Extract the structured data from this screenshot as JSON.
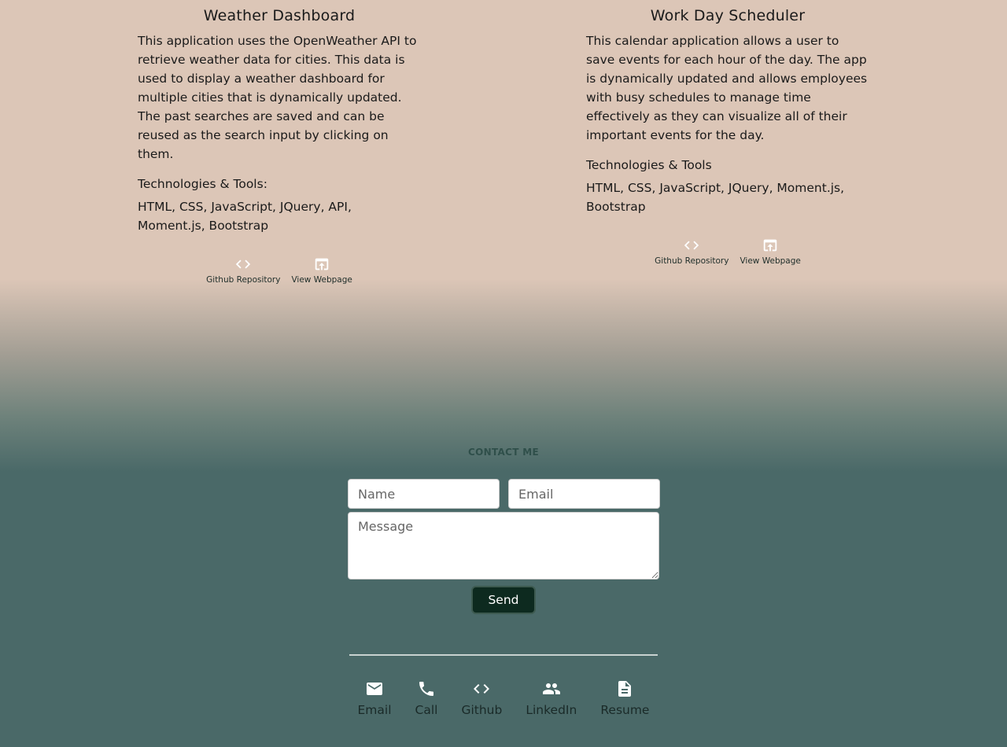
{
  "projects": [
    {
      "title": "Weather Dashboard",
      "description": "This application uses the OpenWeather API to retrieve weather data for cities. This data is used to display a weather dashboard for multiple cities that is dynamically updated. The past searches are saved and can be reused as the search input by clicking on them.",
      "tech_label": "Technologies & Tools:",
      "tech_list": "HTML, CSS, JavaScript, JQuery, API, Moment.js, Bootstrap",
      "repo_label": "Github Repository",
      "repo_icon": "code-icon",
      "webpage_label": "View Webpage",
      "webpage_icon": "open-in-browser-icon"
    },
    {
      "title": "Work Day Scheduler",
      "description": "This calendar application allows a user to save events for each hour of the day. The app is dynamically updated and allows employees with busy schedules to manage time effectively as they can visualize all of their important events for the day.",
      "tech_label": "Technologies & Tools",
      "tech_list": "HTML, CSS, JavaScript, JQuery, Moment.js, Bootstrap",
      "repo_label": "Github Repository",
      "repo_icon": "code-icon",
      "webpage_label": "View Webpage",
      "webpage_icon": "open-in-browser-icon"
    }
  ],
  "contact": {
    "heading": "CONTACT ME",
    "name_placeholder": "Name",
    "email_placeholder": "Email",
    "message_placeholder": "Message",
    "send_label": "Send"
  },
  "footer": {
    "items": [
      {
        "label": "Email",
        "icon": "email-icon"
      },
      {
        "label": "Call",
        "icon": "phone-icon"
      },
      {
        "label": "Github",
        "icon": "code-icon"
      },
      {
        "label": "LinkedIn",
        "icon": "people-icon"
      },
      {
        "label": "Resume",
        "icon": "document-icon"
      }
    ]
  },
  "colors": {
    "top_background": "#dcc6b7",
    "bottom_background": "#4a6968",
    "send_button": "#0d2a1f"
  }
}
